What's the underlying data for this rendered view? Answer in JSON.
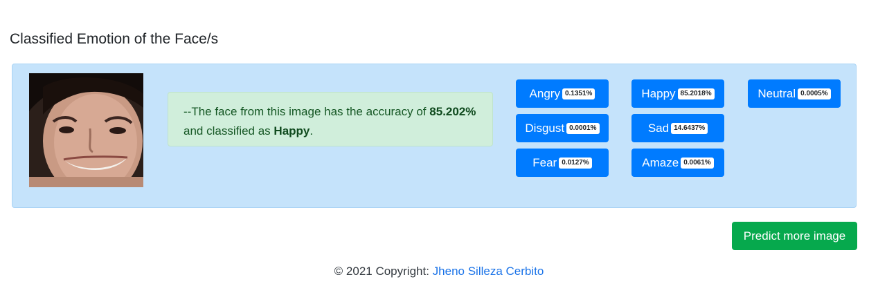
{
  "page": {
    "title": "Classified Emotion of the Face/s"
  },
  "result": {
    "summary_prefix": "--The face from this image has the accuracy of",
    "accuracy": "85.202%",
    "summary_middle": "and classified as",
    "emotion": "Happy",
    "summary_suffix": "."
  },
  "emotions": [
    {
      "label": "Angry",
      "value": "0.1351%"
    },
    {
      "label": "Happy",
      "value": "85.2018%"
    },
    {
      "label": "Neutral",
      "value": "0.0005%"
    },
    {
      "label": "Disgust",
      "value": "0.0001%"
    },
    {
      "label": "Sad",
      "value": "14.6437%"
    },
    {
      "label": "Fear",
      "value": "0.0127%"
    },
    {
      "label": "Amaze",
      "value": "0.0061%"
    }
  ],
  "actions": {
    "predict_label": "Predict more image"
  },
  "footer": {
    "copyright": "© 2021 Copyright:",
    "author": "Jheno Silleza Cerbito"
  },
  "colors": {
    "card_bg": "#c5e3fb",
    "summary_bg": "#d0eedb",
    "emotion_button": "#007bff",
    "predict_button": "#06a94d",
    "link": "#1a73e8"
  }
}
